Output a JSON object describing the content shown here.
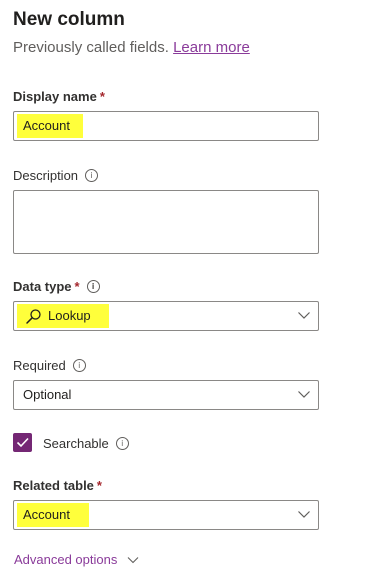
{
  "panel": {
    "title": "New column",
    "subtitle": "Previously called fields.",
    "learn_more": "Learn more"
  },
  "display_name": {
    "label": "Display name",
    "required_mark": "*",
    "value": "Account"
  },
  "description": {
    "label": "Description",
    "info": "i",
    "value": ""
  },
  "data_type": {
    "label": "Data type",
    "required_mark": "*",
    "info": "i",
    "icon": "search-icon",
    "value": "Lookup"
  },
  "required": {
    "label": "Required",
    "info": "i",
    "value": "Optional"
  },
  "searchable": {
    "label": "Searchable",
    "info": "i",
    "checked": true
  },
  "related_table": {
    "label": "Related table",
    "required_mark": "*",
    "value": "Account"
  },
  "advanced_options": {
    "label": "Advanced options"
  },
  "colors": {
    "accent": "#742774",
    "link": "#8a3b9a",
    "highlight": "#ffff3b",
    "required": "#a4262c"
  }
}
